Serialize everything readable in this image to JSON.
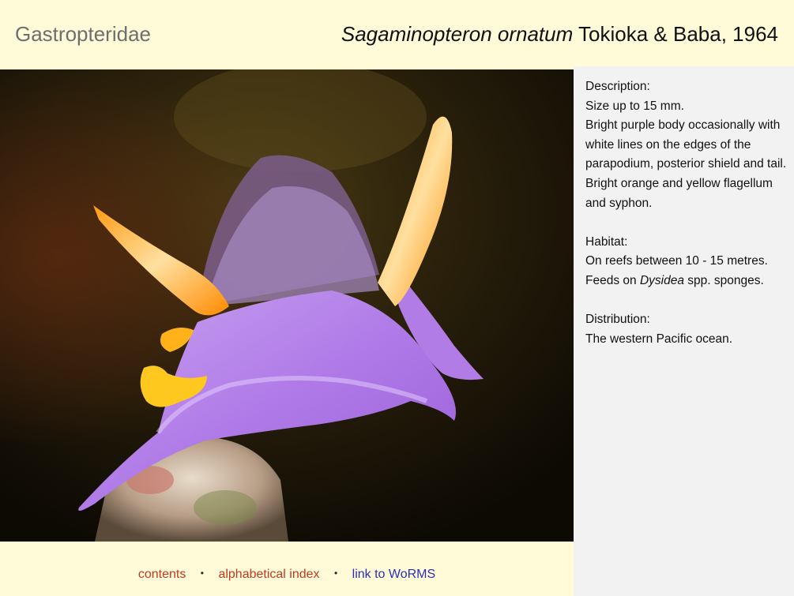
{
  "header": {
    "family": "Gastropteridae",
    "species": "Sagaminopteron ornatum",
    "authority": "Tokioka & Baba, 1964"
  },
  "photo": {
    "subject": "purple sea slug with orange tips"
  },
  "sidebar": {
    "description_heading": "Description:",
    "description_lines": [
      "Size up to 15 mm.",
      "Bright purple body occasionally with white lines on the edges of the parapodium, posterior shield and tail.  Bright orange and yellow flagellum and syphon."
    ],
    "habitat_heading": "Habitat:",
    "habitat_line1": "On reefs between 10 - 15 metres.",
    "habitat_line2_prefix": "Feeds on ",
    "habitat_line2_genus": "Dysidea",
    "habitat_line2_suffix": " spp. sponges.",
    "distribution_heading": "Distribution:",
    "distribution_line": "The western Pacific ocean."
  },
  "footer": {
    "contents": "contents",
    "alphabetical_index": "alphabetical index",
    "worms": "link to WoRMS",
    "separator": "•"
  },
  "colors": {
    "background": "#fffbd9",
    "sidebar": "#f2f2f2",
    "link_red": "#c23a1f",
    "link_blue": "#2c2fb0"
  }
}
